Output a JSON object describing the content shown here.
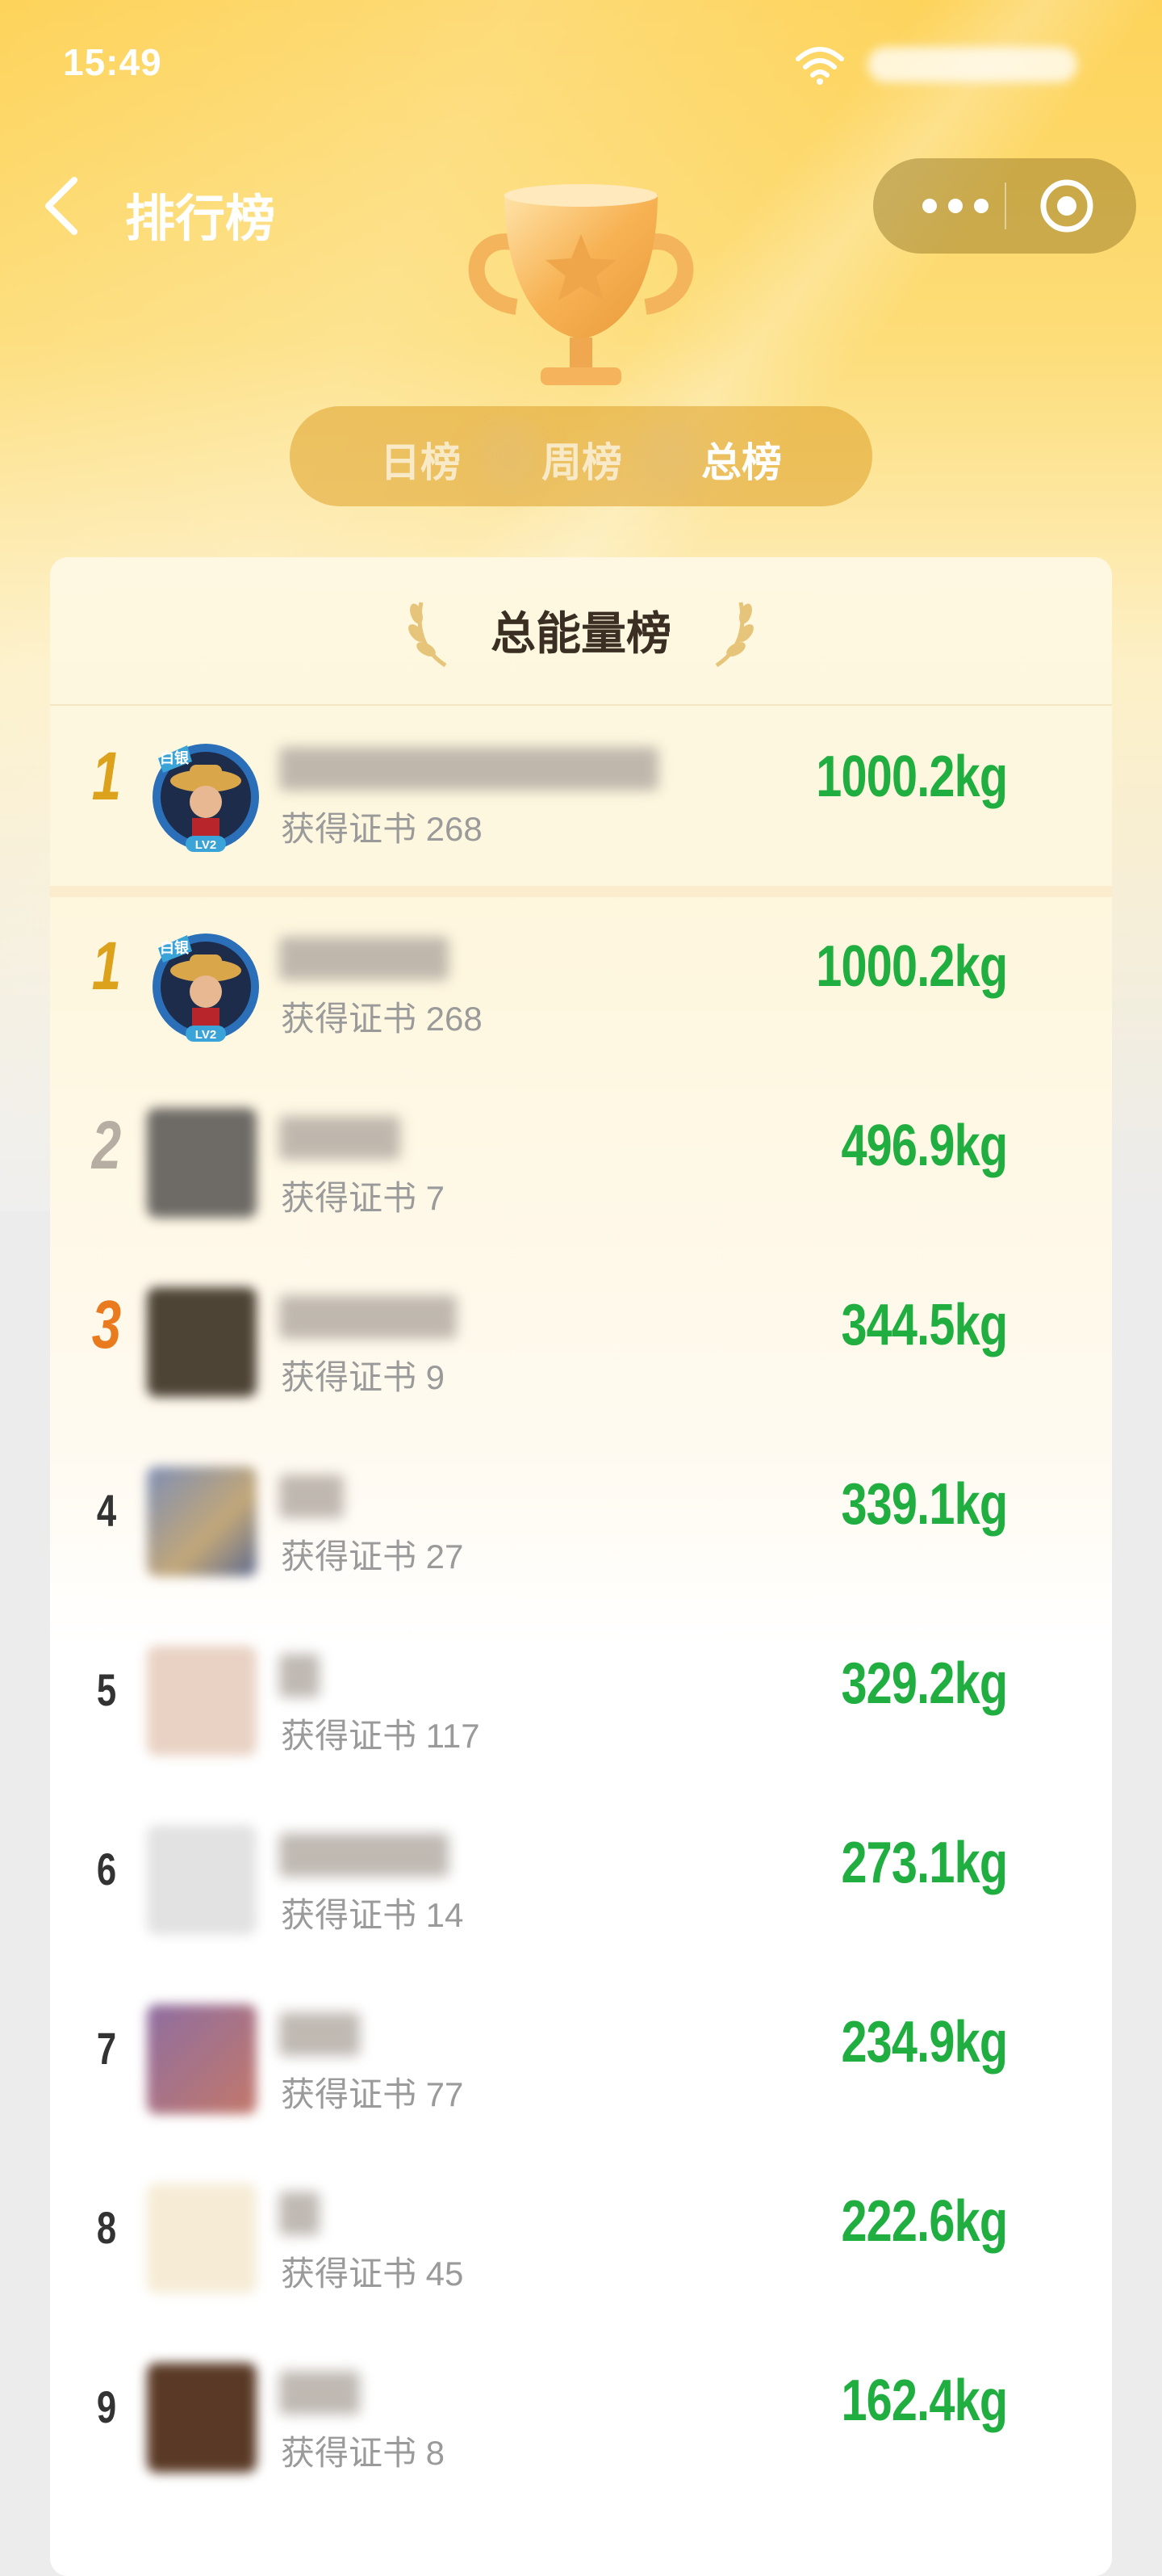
{
  "status_bar": {
    "time": "15:49"
  },
  "nav": {
    "title": "排行榜"
  },
  "tabs": [
    {
      "label": "日榜",
      "active": false
    },
    {
      "label": "周榜",
      "active": false
    },
    {
      "label": "总榜",
      "active": true
    }
  ],
  "board": {
    "title": "总能量榜",
    "my_entry": {
      "rank": "1",
      "certs": "获得证书 268",
      "energy": "1000.2kg",
      "badge": "白银",
      "level": "LV2"
    },
    "entries": [
      {
        "rank": "1",
        "certs": "获得证书 268",
        "energy": "1000.2kg"
      },
      {
        "rank": "2",
        "certs": "获得证书 7",
        "energy": "496.9kg"
      },
      {
        "rank": "3",
        "certs": "获得证书 9",
        "energy": "344.5kg"
      },
      {
        "rank": "4",
        "certs": "获得证书 27",
        "energy": "339.1kg"
      },
      {
        "rank": "5",
        "certs": "获得证书 117",
        "energy": "329.2kg"
      },
      {
        "rank": "6",
        "certs": "获得证书 14",
        "energy": "273.1kg"
      },
      {
        "rank": "7",
        "certs": "获得证书 77",
        "energy": "234.9kg"
      },
      {
        "rank": "8",
        "certs": "获得证书 45",
        "energy": "222.6kg"
      },
      {
        "rank": "9",
        "certs": "获得证书 8",
        "energy": "162.4kg"
      }
    ]
  },
  "colors": {
    "energy_green": "#1fae3f",
    "gold": "#dca21b",
    "silver": "#b7aea3",
    "bronze": "#e97a1e",
    "hero_yellow": "#fdd35a"
  }
}
